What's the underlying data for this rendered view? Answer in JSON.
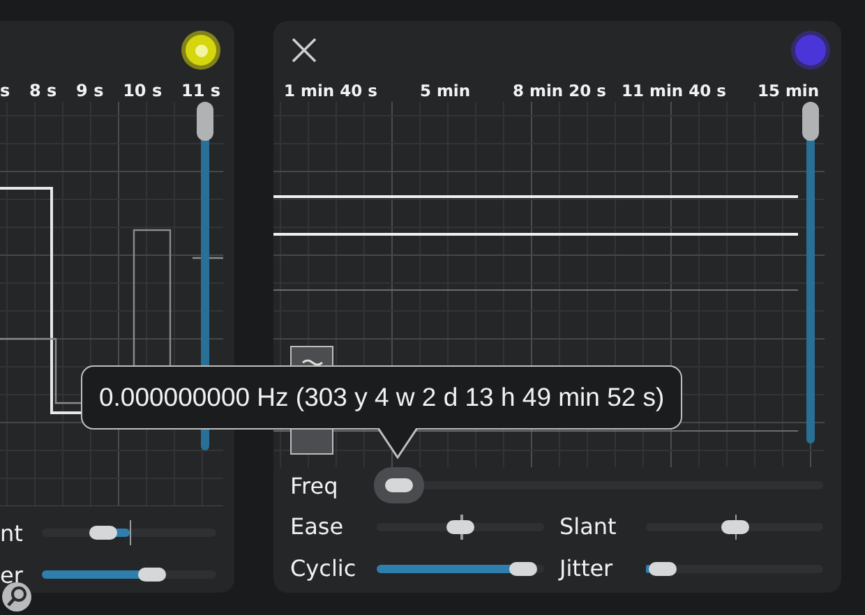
{
  "left_panel": {
    "color": "#d6d60e",
    "time_ticks": [
      "s",
      "8 s",
      "9 s",
      "10 s",
      "11 s"
    ],
    "vertical_slider": {
      "level": 1
    },
    "controls": [
      {
        "label": "nt",
        "kind": "bipolar",
        "level": 0.32
      },
      {
        "label": "er",
        "kind": "unipolar",
        "level": 0.66
      }
    ]
  },
  "right_panel": {
    "color": "#4a35d8",
    "time_ticks": [
      "1 min 40 s",
      "5 min",
      "8 min 20 s",
      "11 min 40 s",
      "15 min"
    ],
    "vertical_slider": {
      "level": 1
    },
    "freq": {
      "label": "Freq",
      "level": 0.02,
      "focused": true
    },
    "controls": [
      {
        "label": "Ease",
        "kind": "bipolar",
        "level": 0.5
      },
      {
        "label": "Slant",
        "kind": "bipolar",
        "level": 0.5
      },
      {
        "label": "Cyclic",
        "kind": "unipolar",
        "level": 0.95
      },
      {
        "label": "Jitter",
        "kind": "unipolar",
        "level": 0.02
      }
    ]
  },
  "tooltip": {
    "text": "0.000000000 Hz (303 y 4 w 2 d 13 h 49 min 52 s)"
  }
}
